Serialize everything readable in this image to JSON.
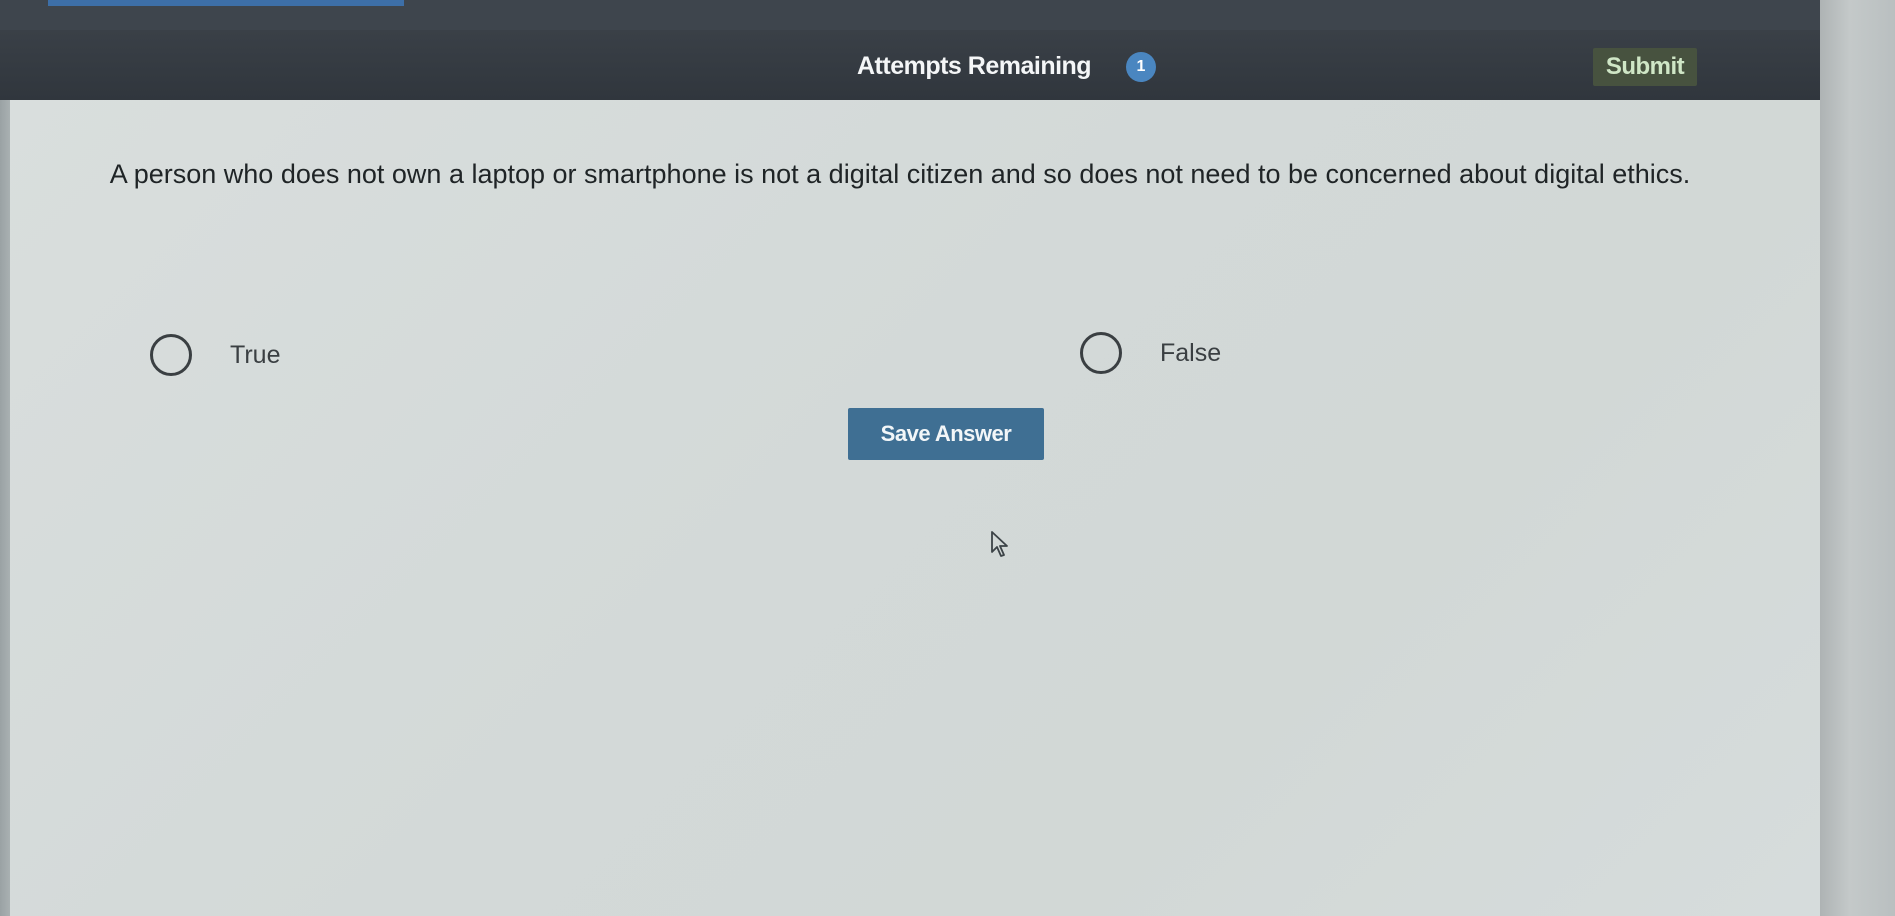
{
  "header": {
    "attempts_label": "Attempts Remaining",
    "attempts_count": "1",
    "submit_label": "Submit"
  },
  "question": {
    "text": "A person who does not own a laptop or smartphone is not a digital citizen and so does not need to be concerned about digital ethics."
  },
  "options": [
    {
      "label": "True"
    },
    {
      "label": "False"
    }
  ],
  "actions": {
    "save_label": "Save Answer"
  },
  "icons": {
    "cursor": "mouse-pointer-icon",
    "radio": "radio-unchecked-icon"
  },
  "colors": {
    "header_bg": "#30363d",
    "badge_bg": "#4a86c0",
    "submit_bg": "#47523f",
    "save_bg": "#3f6f93",
    "content_bg": "#d6dcdb"
  }
}
